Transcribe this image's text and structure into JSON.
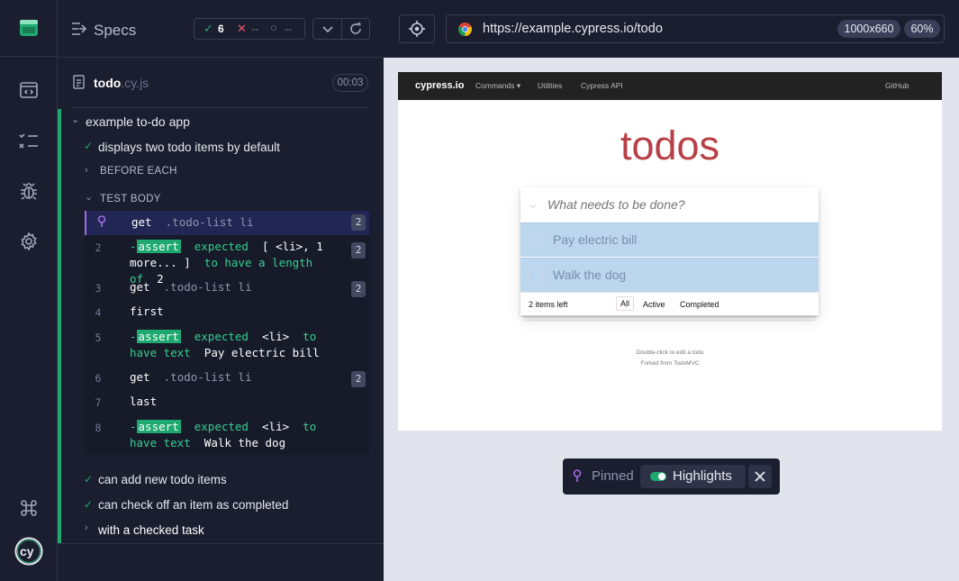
{
  "specs": {
    "title": "Specs",
    "passed": "6",
    "failed": "--",
    "pending": "--"
  },
  "file": {
    "name": "todo",
    "ext": ".cy.js",
    "duration": "00:03"
  },
  "suite": {
    "name": "example to-do app"
  },
  "test": {
    "name": "displays two todo items by default",
    "before_each": "BEFORE EACH",
    "test_body": "TEST BODY"
  },
  "commands": [
    {
      "num": "",
      "name": "get",
      "arg": ".todo-list li",
      "badge": "2"
    },
    {
      "num": "2",
      "prefix": "-",
      "name": "assert",
      "msg1": "expected",
      "msg2": "[ <li>, 1 more... ]",
      "msg3": "to have a length of",
      "msg4": "2",
      "badge": "2"
    },
    {
      "num": "3",
      "name": "get",
      "arg": ".todo-list li",
      "badge": "2"
    },
    {
      "num": "4",
      "name": "first"
    },
    {
      "num": "5",
      "prefix": "-",
      "name": "assert",
      "msg1": "expected",
      "msg2": "<li>",
      "msg3": "to have text",
      "msg4": "Pay electric bill"
    },
    {
      "num": "6",
      "name": "get",
      "arg": ".todo-list li",
      "badge": "2"
    },
    {
      "num": "7",
      "name": "last"
    },
    {
      "num": "8",
      "prefix": "-",
      "name": "assert",
      "msg1": "expected",
      "msg2": "<li>",
      "msg3": "to have text",
      "msg4": "Walk the dog"
    }
  ],
  "other_tests": [
    "can add new todo items",
    "can check off an item as completed"
  ],
  "sub_suite": "with a checked task",
  "browser": {
    "url": "https://example.cypress.io/todo",
    "viewport": "1000x660",
    "zoom": "60%"
  },
  "aut": {
    "nav": {
      "brand": "cypress.io",
      "commands": "Commands",
      "utilities": "Utilities",
      "api": "Cypress API",
      "github": "GitHub"
    },
    "title": "todos",
    "placeholder": "What needs to be done?",
    "items": [
      "Pay electric bill",
      "Walk the dog"
    ],
    "footer": {
      "left": "2 items left",
      "all": "All",
      "active": "Active",
      "completed": "Completed"
    },
    "info": [
      "Double-click to edit a todo",
      "Forked from TodoMVC"
    ]
  },
  "pinned": {
    "label": "Pinned",
    "highlights": "Highlights"
  },
  "colors": {
    "accent": "#1fa971",
    "pin": "#a06ce4",
    "todos_title": "#b83f45"
  }
}
